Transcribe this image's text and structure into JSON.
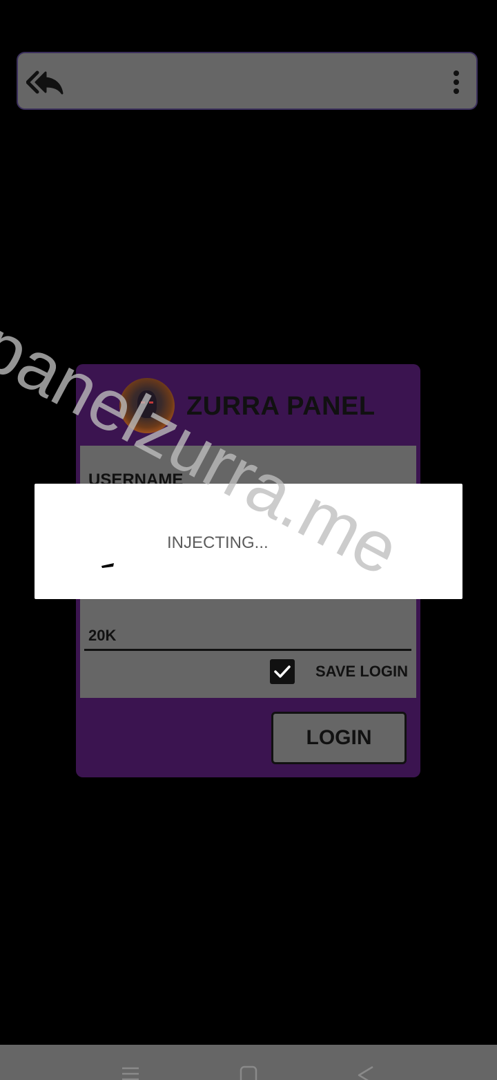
{
  "app": {
    "card_title": "ZURRA PANEL",
    "accent_color": "#3b1450",
    "panel_color": "#666666"
  },
  "topbar": {
    "back_icon": "double-reply-arrow-icon",
    "menu_icon": "more-vertical-icon"
  },
  "form": {
    "username_label": "USERNAME",
    "key_value": "20K",
    "save_login_label": "SAVE LOGIN",
    "save_login_checked": true,
    "login_label": "LOGIN"
  },
  "dialog": {
    "message": "INJECTING..."
  },
  "watermark": {
    "text": "panelzurra.me"
  },
  "navbar": {
    "icons": [
      "menu-icon",
      "home-square-icon",
      "back-triangle-icon"
    ]
  }
}
